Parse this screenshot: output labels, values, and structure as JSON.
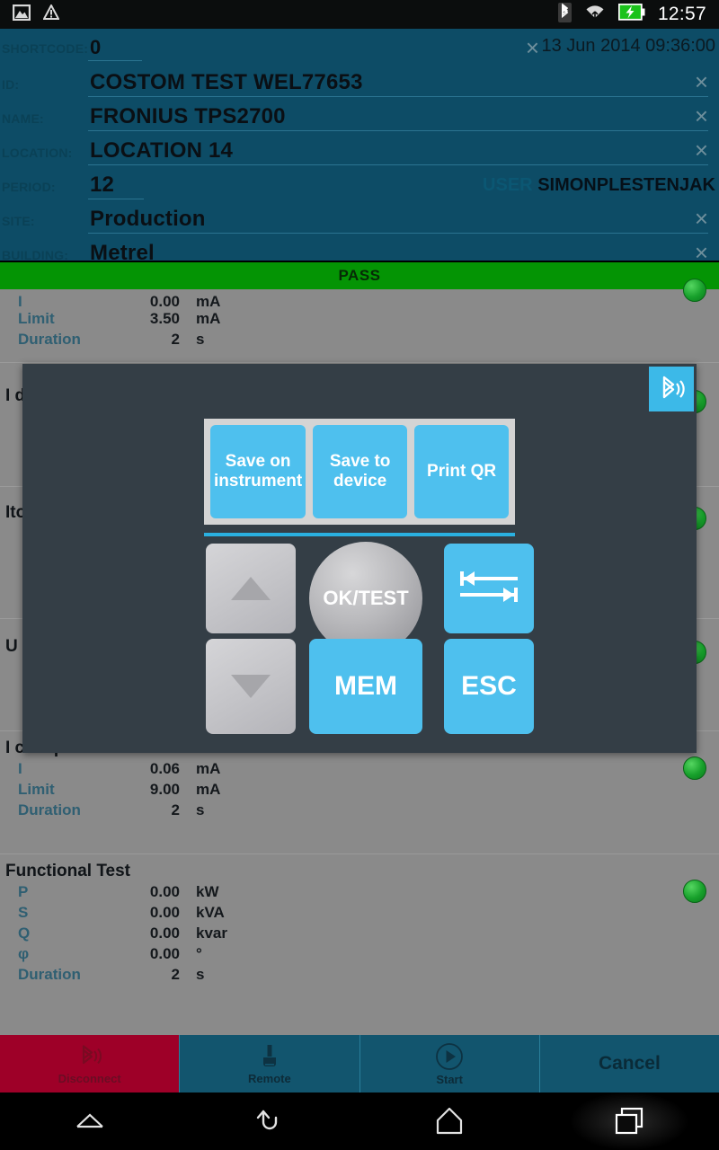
{
  "statusbar": {
    "time": "12:57",
    "icons_left": [
      "image-icon",
      "warning-icon"
    ],
    "icons_right": [
      "bluetooth-icon",
      "wifi-icon",
      "battery-charging-icon"
    ]
  },
  "form": {
    "rows": [
      {
        "label": "SHORTCODE:",
        "value": "0",
        "clear": "×"
      },
      {
        "label": "ID:",
        "value": "COSTOM TEST WEL77653",
        "clear": "×"
      },
      {
        "label": "NAME:",
        "value": "FRONIUS TPS2700",
        "clear": "×"
      },
      {
        "label": "LOCATION:",
        "value": "LOCATION 14",
        "clear": "×"
      },
      {
        "label": "PERIOD:",
        "value": "12",
        "clear": ""
      },
      {
        "label": "SITE:",
        "value": "Production",
        "clear": "×"
      },
      {
        "label": "BUILDING:",
        "value": "Metrel",
        "clear": "×"
      }
    ],
    "timestamp": "13 Jun 2014 09:36:00",
    "user_label": "USER",
    "user_value": "SIMONPLESTENJAK"
  },
  "status": {
    "pass_label": "PASS",
    "pass_color": "#049404"
  },
  "results": {
    "blocks": [
      {
        "title": "",
        "rows": [
          {
            "name": "I",
            "value": "0.00",
            "unit": "mA"
          },
          {
            "name": "Limit",
            "value": "3.50",
            "unit": "mA"
          },
          {
            "name": "Duration",
            "value": "2",
            "unit": "s"
          }
        ]
      },
      {
        "title": "I d",
        "rows": []
      },
      {
        "title": "Ito",
        "rows": []
      },
      {
        "title": "U l",
        "rows": []
      },
      {
        "title": "I clamp",
        "rows": [
          {
            "name": "I",
            "value": "0.06",
            "unit": "mA"
          },
          {
            "name": "Limit",
            "value": "9.00",
            "unit": "mA"
          },
          {
            "name": "Duration",
            "value": "2",
            "unit": "s"
          }
        ]
      },
      {
        "title": "Functional Test",
        "rows": [
          {
            "name": "P",
            "value": "0.00",
            "unit": "kW"
          },
          {
            "name": "S",
            "value": "0.00",
            "unit": "kVA"
          },
          {
            "name": "Q",
            "value": "0.00",
            "unit": "kvar"
          },
          {
            "name": "φ",
            "value": "0.00",
            "unit": "°"
          },
          {
            "name": "Duration",
            "value": "2",
            "unit": "s"
          }
        ]
      }
    ]
  },
  "dialog": {
    "bluetooth_icon": "bluetooth-icon",
    "save_buttons": [
      {
        "label": "Save on instrument"
      },
      {
        "label": "Save to device"
      },
      {
        "label": "Print QR"
      }
    ],
    "keys": {
      "up": "arrow-up-icon",
      "down": "arrow-down-icon",
      "ok": "OK/TEST",
      "tab": "tab-swap-icon",
      "mem": "MEM",
      "esc": "ESC"
    },
    "accent_color": "#4ec0ee"
  },
  "toolbar": {
    "buttons": [
      {
        "label": "Disconnect",
        "icon": "bluetooth-icon",
        "style": "danger"
      },
      {
        "label": "Remote",
        "icon": "probe-icon",
        "style": "normal"
      },
      {
        "label": "Start",
        "icon": "play-icon",
        "style": "normal"
      },
      {
        "label": "Cancel",
        "icon": "",
        "style": "plain"
      }
    ]
  },
  "navbar": {
    "items": [
      {
        "name": "menu-up-icon"
      },
      {
        "name": "back-icon"
      },
      {
        "name": "home-icon"
      },
      {
        "name": "recents-icon"
      }
    ]
  }
}
